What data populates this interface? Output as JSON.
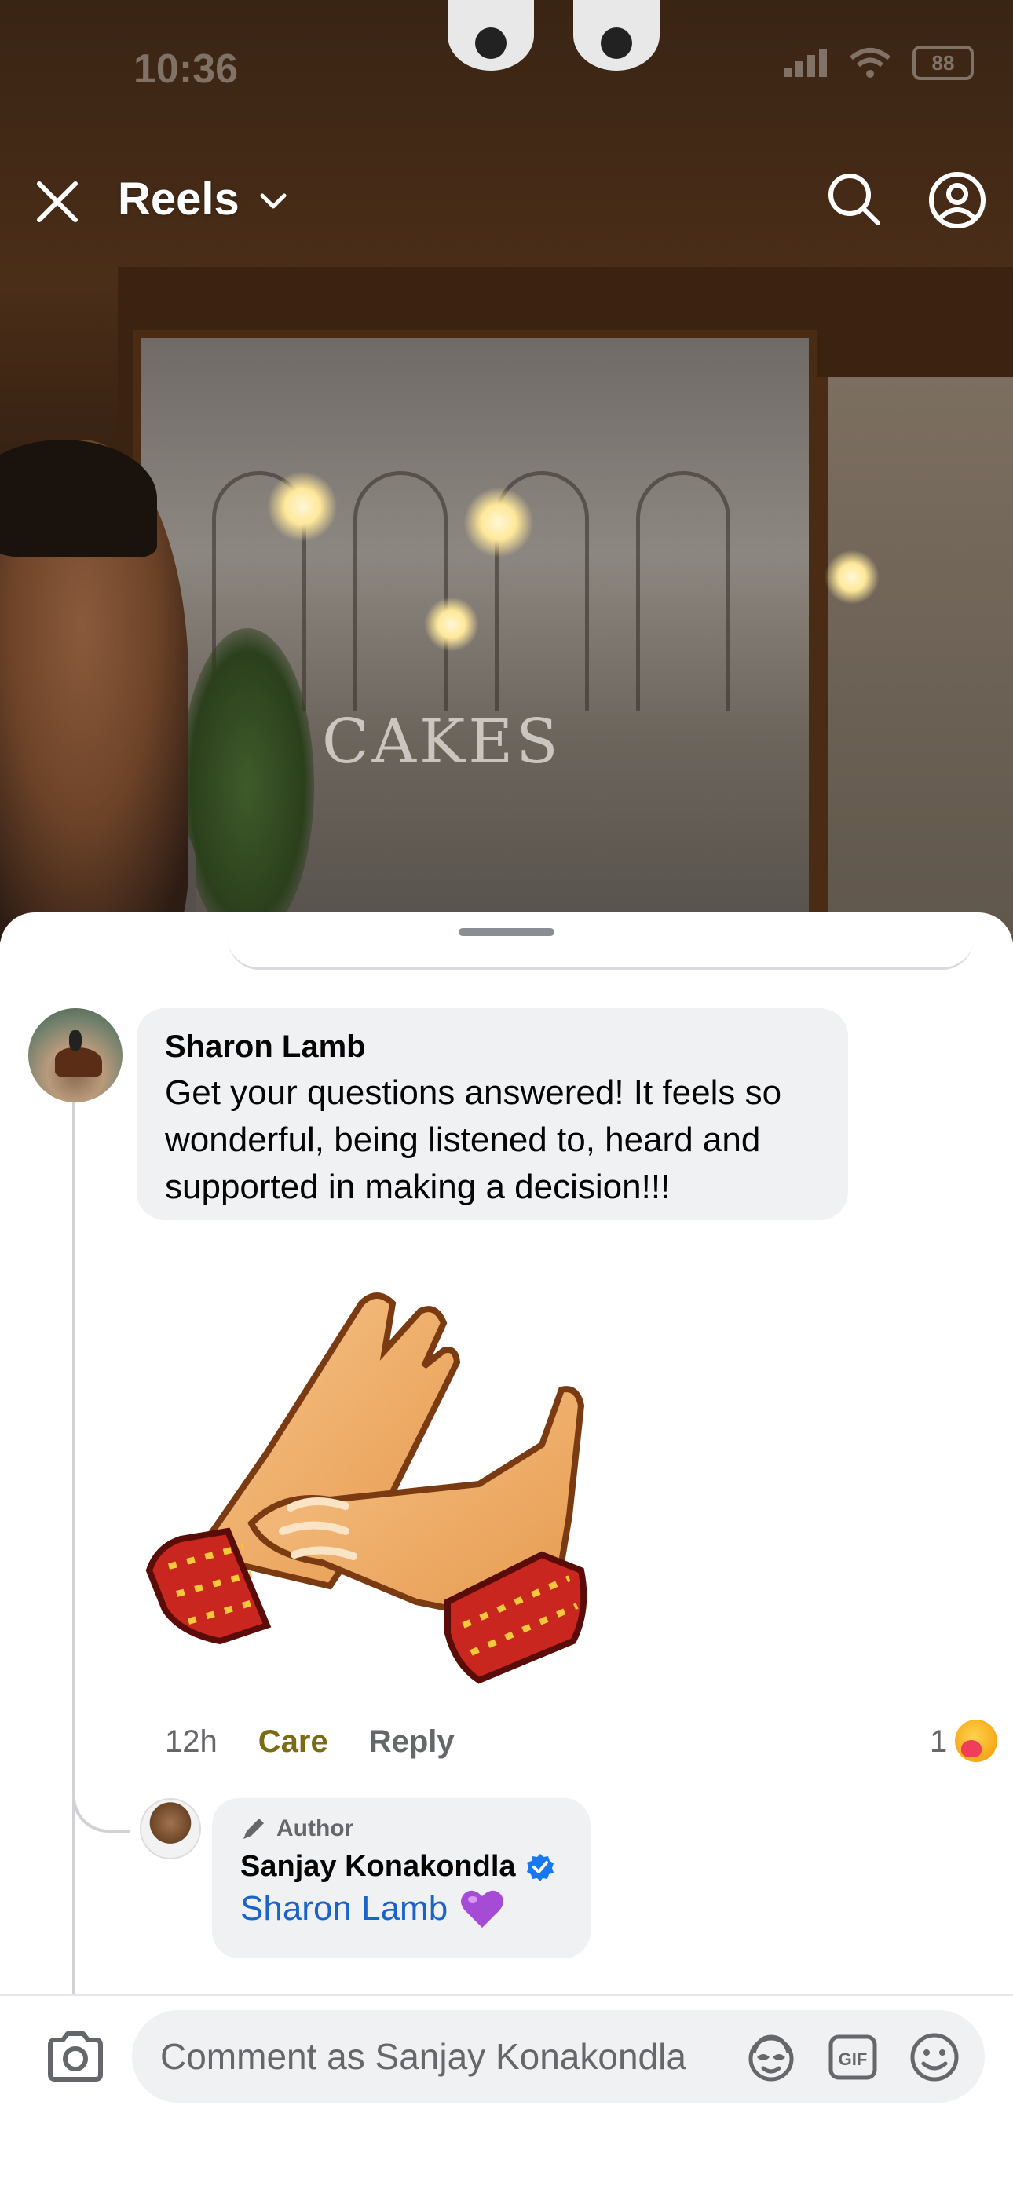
{
  "status_bar": {
    "time": "10:36",
    "battery": "88"
  },
  "top_bar": {
    "title": "Reels"
  },
  "video": {
    "window_text": "CAKES"
  },
  "comments": [
    {
      "author": "Sharon Lamb",
      "text": "Get your questions answered!  It feels so wonderful, being listened to, heard and supported in making a decision!!!",
      "time": "12h",
      "reaction_label": "Care",
      "reply_label": "Reply",
      "reaction_count": "1",
      "sticker": "clapping-hands-sticker"
    }
  ],
  "reply": {
    "badge": "Author",
    "author": "Sanjay Konakondla",
    "verified": true,
    "mention": "Sharon Lamb",
    "emoji": "purple-heart"
  },
  "composer": {
    "placeholder": "Comment as Sanjay Konakondla"
  },
  "colors": {
    "care": "#7c6a14",
    "mention": "#1b63c9",
    "verified": "#1877f2",
    "bubble": "#f0f1f3"
  }
}
